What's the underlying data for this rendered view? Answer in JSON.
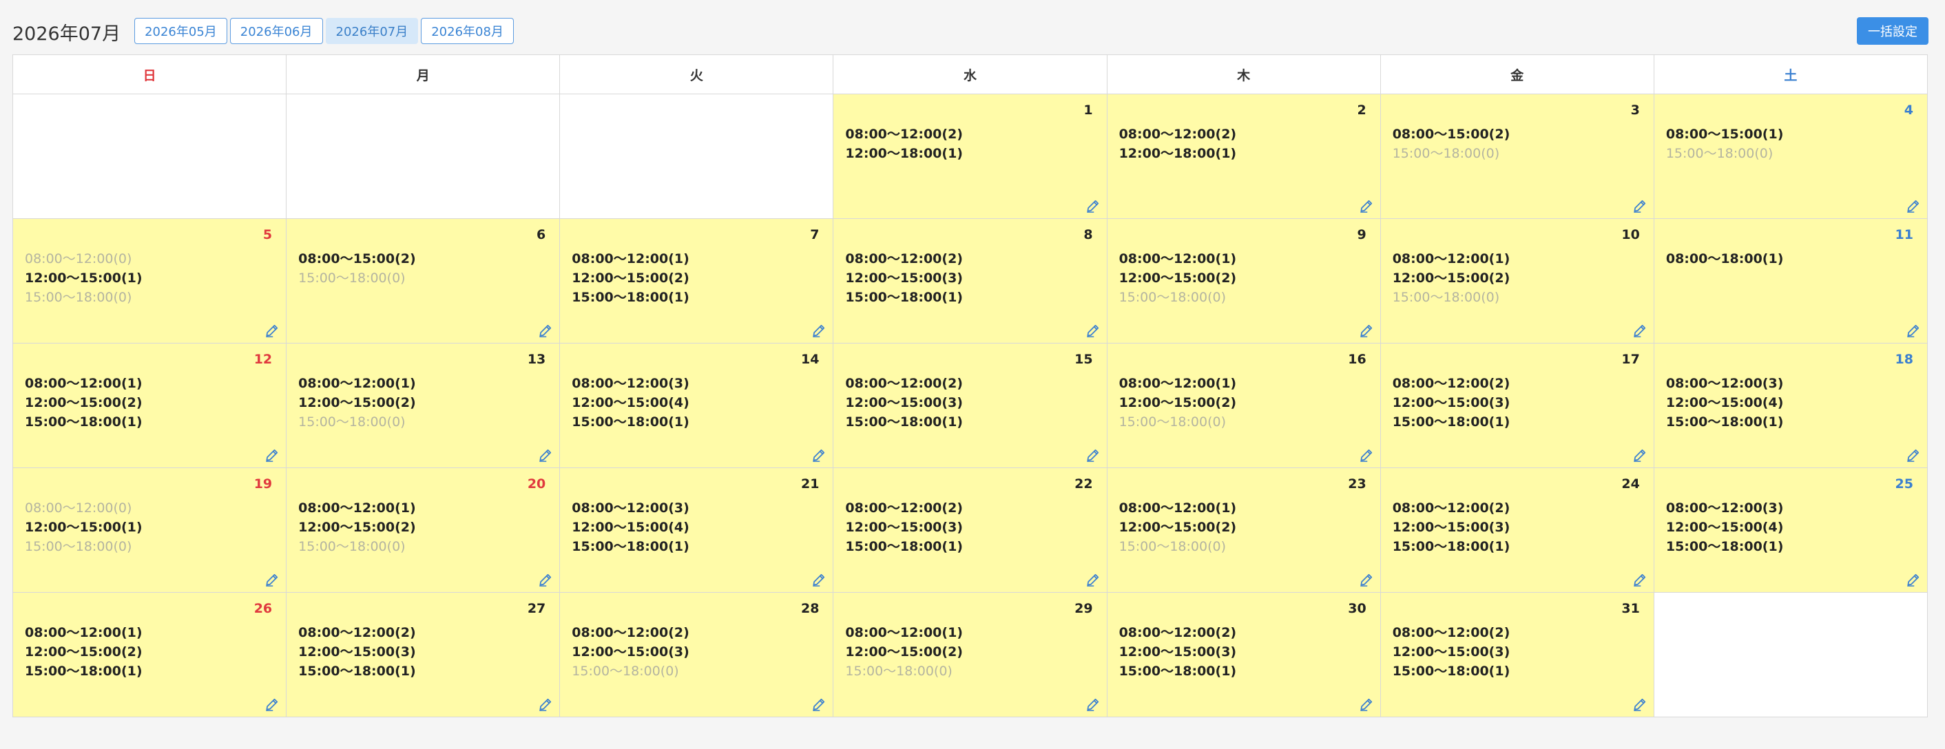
{
  "header": {
    "current_month": "2026年07月",
    "months": [
      {
        "label": "2026年05月",
        "active": false
      },
      {
        "label": "2026年06月",
        "active": false
      },
      {
        "label": "2026年07月",
        "active": true
      },
      {
        "label": "2026年08月",
        "active": false
      }
    ],
    "bulk_label": "一括設定"
  },
  "weekdays": [
    "日",
    "月",
    "火",
    "水",
    "木",
    "金",
    "土"
  ],
  "colors": {
    "sunday": "#e0393e",
    "saturday": "#3a7fd0",
    "holiday": "#e0393e",
    "filled_cell": "#fffba8",
    "accent": "#3b8fe6"
  },
  "days": [
    {
      "day": 1,
      "dow": 3,
      "slots": [
        {
          "text": "08:00～12:00(2)",
          "count": 2
        },
        {
          "text": "12:00～18:00(1)",
          "count": 1
        }
      ]
    },
    {
      "day": 2,
      "dow": 4,
      "slots": [
        {
          "text": "08:00～12:00(2)",
          "count": 2
        },
        {
          "text": "12:00～18:00(1)",
          "count": 1
        }
      ]
    },
    {
      "day": 3,
      "dow": 5,
      "slots": [
        {
          "text": "08:00～15:00(2)",
          "count": 2
        },
        {
          "text": "15:00～18:00(0)",
          "count": 0
        }
      ]
    },
    {
      "day": 4,
      "dow": 6,
      "slots": [
        {
          "text": "08:00～15:00(1)",
          "count": 1
        },
        {
          "text": "15:00～18:00(0)",
          "count": 0
        }
      ]
    },
    {
      "day": 5,
      "dow": 0,
      "slots": [
        {
          "text": "08:00～12:00(0)",
          "count": 0
        },
        {
          "text": "12:00～15:00(1)",
          "count": 1
        },
        {
          "text": "15:00～18:00(0)",
          "count": 0
        }
      ]
    },
    {
      "day": 6,
      "dow": 1,
      "slots": [
        {
          "text": "08:00～15:00(2)",
          "count": 2
        },
        {
          "text": "15:00～18:00(0)",
          "count": 0
        }
      ]
    },
    {
      "day": 7,
      "dow": 2,
      "slots": [
        {
          "text": "08:00～12:00(1)",
          "count": 1
        },
        {
          "text": "12:00～15:00(2)",
          "count": 2
        },
        {
          "text": "15:00～18:00(1)",
          "count": 1
        }
      ]
    },
    {
      "day": 8,
      "dow": 3,
      "slots": [
        {
          "text": "08:00～12:00(2)",
          "count": 2
        },
        {
          "text": "12:00～15:00(3)",
          "count": 3
        },
        {
          "text": "15:00～18:00(1)",
          "count": 1
        }
      ]
    },
    {
      "day": 9,
      "dow": 4,
      "slots": [
        {
          "text": "08:00～12:00(1)",
          "count": 1
        },
        {
          "text": "12:00～15:00(2)",
          "count": 2
        },
        {
          "text": "15:00～18:00(0)",
          "count": 0
        }
      ]
    },
    {
      "day": 10,
      "dow": 5,
      "slots": [
        {
          "text": "08:00～12:00(1)",
          "count": 1
        },
        {
          "text": "12:00～15:00(2)",
          "count": 2
        },
        {
          "text": "15:00～18:00(0)",
          "count": 0
        }
      ]
    },
    {
      "day": 11,
      "dow": 6,
      "slots": [
        {
          "text": "08:00～18:00(1)",
          "count": 1
        }
      ]
    },
    {
      "day": 12,
      "dow": 0,
      "slots": [
        {
          "text": "08:00～12:00(1)",
          "count": 1
        },
        {
          "text": "12:00～15:00(2)",
          "count": 2
        },
        {
          "text": "15:00～18:00(1)",
          "count": 1
        }
      ]
    },
    {
      "day": 13,
      "dow": 1,
      "slots": [
        {
          "text": "08:00～12:00(1)",
          "count": 1
        },
        {
          "text": "12:00～15:00(2)",
          "count": 2
        },
        {
          "text": "15:00～18:00(0)",
          "count": 0
        }
      ]
    },
    {
      "day": 14,
      "dow": 2,
      "slots": [
        {
          "text": "08:00～12:00(3)",
          "count": 3
        },
        {
          "text": "12:00～15:00(4)",
          "count": 4
        },
        {
          "text": "15:00～18:00(1)",
          "count": 1
        }
      ]
    },
    {
      "day": 15,
      "dow": 3,
      "slots": [
        {
          "text": "08:00～12:00(2)",
          "count": 2
        },
        {
          "text": "12:00～15:00(3)",
          "count": 3
        },
        {
          "text": "15:00～18:00(1)",
          "count": 1
        }
      ]
    },
    {
      "day": 16,
      "dow": 4,
      "slots": [
        {
          "text": "08:00～12:00(1)",
          "count": 1
        },
        {
          "text": "12:00～15:00(2)",
          "count": 2
        },
        {
          "text": "15:00～18:00(0)",
          "count": 0
        }
      ]
    },
    {
      "day": 17,
      "dow": 5,
      "slots": [
        {
          "text": "08:00～12:00(2)",
          "count": 2
        },
        {
          "text": "12:00～15:00(3)",
          "count": 3
        },
        {
          "text": "15:00～18:00(1)",
          "count": 1
        }
      ]
    },
    {
      "day": 18,
      "dow": 6,
      "slots": [
        {
          "text": "08:00～12:00(3)",
          "count": 3
        },
        {
          "text": "12:00～15:00(4)",
          "count": 4
        },
        {
          "text": "15:00～18:00(1)",
          "count": 1
        }
      ]
    },
    {
      "day": 19,
      "dow": 0,
      "slots": [
        {
          "text": "08:00～12:00(0)",
          "count": 0
        },
        {
          "text": "12:00～15:00(1)",
          "count": 1
        },
        {
          "text": "15:00～18:00(0)",
          "count": 0
        }
      ]
    },
    {
      "day": 20,
      "dow": 1,
      "holiday": true,
      "slots": [
        {
          "text": "08:00～12:00(1)",
          "count": 1
        },
        {
          "text": "12:00～15:00(2)",
          "count": 2
        },
        {
          "text": "15:00～18:00(0)",
          "count": 0
        }
      ]
    },
    {
      "day": 21,
      "dow": 2,
      "slots": [
        {
          "text": "08:00～12:00(3)",
          "count": 3
        },
        {
          "text": "12:00～15:00(4)",
          "count": 4
        },
        {
          "text": "15:00～18:00(1)",
          "count": 1
        }
      ]
    },
    {
      "day": 22,
      "dow": 3,
      "slots": [
        {
          "text": "08:00～12:00(2)",
          "count": 2
        },
        {
          "text": "12:00～15:00(3)",
          "count": 3
        },
        {
          "text": "15:00～18:00(1)",
          "count": 1
        }
      ]
    },
    {
      "day": 23,
      "dow": 4,
      "slots": [
        {
          "text": "08:00～12:00(1)",
          "count": 1
        },
        {
          "text": "12:00～15:00(2)",
          "count": 2
        },
        {
          "text": "15:00～18:00(0)",
          "count": 0
        }
      ]
    },
    {
      "day": 24,
      "dow": 5,
      "slots": [
        {
          "text": "08:00～12:00(2)",
          "count": 2
        },
        {
          "text": "12:00～15:00(3)",
          "count": 3
        },
        {
          "text": "15:00～18:00(1)",
          "count": 1
        }
      ]
    },
    {
      "day": 25,
      "dow": 6,
      "slots": [
        {
          "text": "08:00～12:00(3)",
          "count": 3
        },
        {
          "text": "12:00～15:00(4)",
          "count": 4
        },
        {
          "text": "15:00～18:00(1)",
          "count": 1
        }
      ]
    },
    {
      "day": 26,
      "dow": 0,
      "slots": [
        {
          "text": "08:00～12:00(1)",
          "count": 1
        },
        {
          "text": "12:00～15:00(2)",
          "count": 2
        },
        {
          "text": "15:00～18:00(1)",
          "count": 1
        }
      ]
    },
    {
      "day": 27,
      "dow": 1,
      "slots": [
        {
          "text": "08:00～12:00(2)",
          "count": 2
        },
        {
          "text": "12:00～15:00(3)",
          "count": 3
        },
        {
          "text": "15:00～18:00(1)",
          "count": 1
        }
      ]
    },
    {
      "day": 28,
      "dow": 2,
      "slots": [
        {
          "text": "08:00～12:00(2)",
          "count": 2
        },
        {
          "text": "12:00～15:00(3)",
          "count": 3
        },
        {
          "text": "15:00～18:00(0)",
          "count": 0
        }
      ]
    },
    {
      "day": 29,
      "dow": 3,
      "slots": [
        {
          "text": "08:00～12:00(1)",
          "count": 1
        },
        {
          "text": "12:00～15:00(2)",
          "count": 2
        },
        {
          "text": "15:00～18:00(0)",
          "count": 0
        }
      ]
    },
    {
      "day": 30,
      "dow": 4,
      "slots": [
        {
          "text": "08:00～12:00(2)",
          "count": 2
        },
        {
          "text": "12:00～15:00(3)",
          "count": 3
        },
        {
          "text": "15:00～18:00(1)",
          "count": 1
        }
      ]
    },
    {
      "day": 31,
      "dow": 5,
      "slots": [
        {
          "text": "08:00～12:00(2)",
          "count": 2
        },
        {
          "text": "12:00～15:00(3)",
          "count": 3
        },
        {
          "text": "15:00～18:00(1)",
          "count": 1
        }
      ]
    }
  ]
}
